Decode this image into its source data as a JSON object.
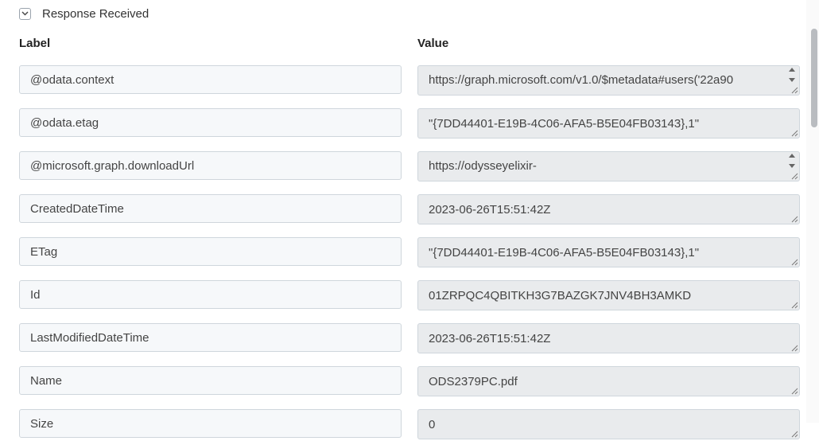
{
  "section": {
    "title": "Response Received",
    "expanded": true
  },
  "columns": {
    "label": "Label",
    "value": "Value"
  },
  "rows": [
    {
      "label": "@odata.context",
      "value": "https://graph.microsoft.com/v1.0/$metadata#users('22a90",
      "scrollable": true
    },
    {
      "label": "@odata.etag",
      "value": "\"{7DD44401-E19B-4C06-AFA5-B5E04FB03143},1\"",
      "scrollable": false
    },
    {
      "label": "@microsoft.graph.downloadUrl",
      "value": "https://odysseyelixir-",
      "scrollable": true
    },
    {
      "label": "CreatedDateTime",
      "value": "2023-06-26T15:51:42Z",
      "scrollable": false
    },
    {
      "label": "ETag",
      "value": "\"{7DD44401-E19B-4C06-AFA5-B5E04FB03143},1\"",
      "scrollable": false
    },
    {
      "label": "Id",
      "value": "01ZRPQC4QBITKH3G7BAZGK7JNV4BH3AMKD",
      "scrollable": false
    },
    {
      "label": "LastModifiedDateTime",
      "value": "2023-06-26T15:51:42Z",
      "scrollable": false
    },
    {
      "label": "Name",
      "value": "ODS2379PC.pdf",
      "scrollable": false
    },
    {
      "label": "Size",
      "value": "0",
      "scrollable": false
    }
  ]
}
